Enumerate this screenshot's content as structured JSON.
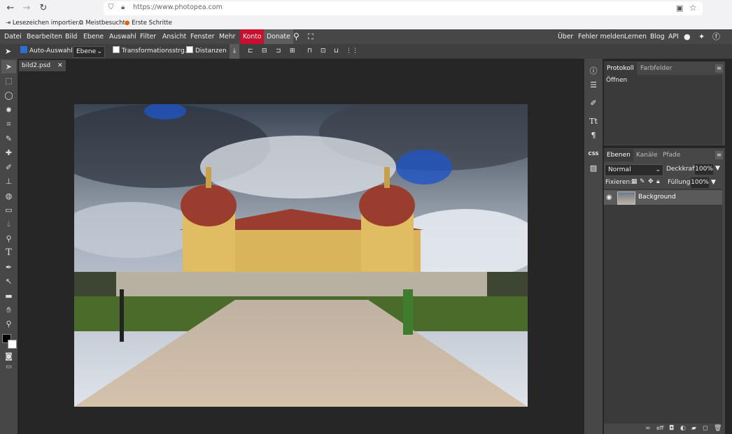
{
  "browser": {
    "url": "https://www.photopea.com",
    "bookmarks": [
      "Lesezeichen importier...",
      "Meistbesucht",
      "Erste Schritte"
    ]
  },
  "menu": {
    "items": [
      "Datei",
      "Bearbeiten",
      "Bild",
      "Ebene",
      "Auswahl",
      "Filter",
      "Ansicht",
      "Fenster",
      "Mehr"
    ],
    "konto": "Konto",
    "donate": "Donate",
    "right": [
      "Über",
      "Fehler melden",
      "Lernen",
      "Blog",
      "API"
    ]
  },
  "options": {
    "auto_select": "Auto-Auswahl",
    "auto_select_target": "Ebene",
    "transform": "Transformationsstrg.",
    "distances": "Distanzen"
  },
  "document": {
    "tab": "bild2.psd"
  },
  "history_panel": {
    "tabs": [
      "Protokoll",
      "Farbfelder"
    ],
    "entries": [
      "Öffnen"
    ]
  },
  "layers_panel": {
    "tabs": [
      "Ebenen",
      "Kanäle",
      "Pfade"
    ],
    "blend_mode": "Normal",
    "opacity_label": "Deckkraft:",
    "opacity": "100%",
    "lock_label": "Fixieren:",
    "fill_label": "Füllung:",
    "fill": "100%",
    "layers": [
      {
        "name": "Background",
        "visible": true
      }
    ]
  },
  "right_icons": {
    "css_label": "CSS"
  },
  "colors": {
    "konto": "#c8102e",
    "accent": "#2d6fd6"
  }
}
